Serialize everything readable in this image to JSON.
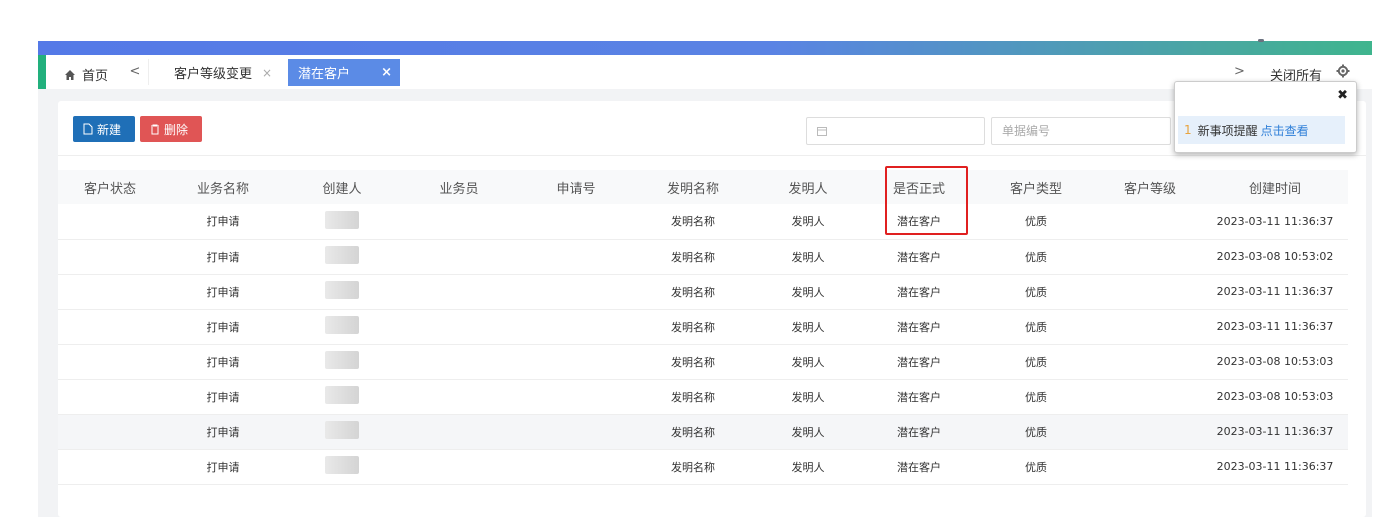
{
  "tabs": {
    "home": "首页",
    "scroll_left": "<",
    "items": [
      {
        "label": "客户等级变更",
        "close": "×"
      },
      {
        "label": "潜在客户",
        "close": "×"
      }
    ],
    "scroll_right": ">",
    "close_all": "关闭所有"
  },
  "toolbar": {
    "new_label": "新建",
    "delete_label": "删除"
  },
  "filters": {
    "date_placeholder": "",
    "number_placeholder": "单据编号"
  },
  "notification": {
    "close": "✖",
    "count": "1",
    "text": "新事项提醒",
    "link": "点击查看"
  },
  "table": {
    "columns": [
      "客户状态",
      "业务名称",
      "创建人",
      "业务员",
      "申请号",
      "发明名称",
      "发明人",
      "是否正式",
      "客户类型",
      "客户等级",
      "创建时间"
    ],
    "rows": [
      {
        "status": "",
        "business": "打申请",
        "creator": "",
        "salesman": "",
        "app_no": "",
        "invention": "发明名称",
        "inventor": "发明人",
        "formal": "潜在客户",
        "ctype": "优质",
        "level": "",
        "created": "2023-03-11 11:36:37"
      },
      {
        "status": "",
        "business": "打申请",
        "creator": "",
        "salesman": "",
        "app_no": "",
        "invention": "发明名称",
        "inventor": "发明人",
        "formal": "潜在客户",
        "ctype": "优质",
        "level": "",
        "created": "2023-03-08 10:53:02"
      },
      {
        "status": "",
        "business": "打申请",
        "creator": "",
        "salesman": "",
        "app_no": "",
        "invention": "发明名称",
        "inventor": "发明人",
        "formal": "潜在客户",
        "ctype": "优质",
        "level": "",
        "created": "2023-03-11 11:36:37"
      },
      {
        "status": "",
        "business": "打申请",
        "creator": "",
        "salesman": "",
        "app_no": "",
        "invention": "发明名称",
        "inventor": "发明人",
        "formal": "潜在客户",
        "ctype": "优质",
        "level": "",
        "created": "2023-03-11 11:36:37"
      },
      {
        "status": "",
        "business": "打申请",
        "creator": "",
        "salesman": "",
        "app_no": "",
        "invention": "发明名称",
        "inventor": "发明人",
        "formal": "潜在客户",
        "ctype": "优质",
        "level": "",
        "created": "2023-03-08 10:53:03"
      },
      {
        "status": "",
        "business": "打申请",
        "creator": "",
        "salesman": "",
        "app_no": "",
        "invention": "发明名称",
        "inventor": "发明人",
        "formal": "潜在客户",
        "ctype": "优质",
        "level": "",
        "created": "2023-03-08 10:53:03"
      },
      {
        "status": "",
        "business": "打申请",
        "creator": "",
        "salesman": "",
        "app_no": "",
        "invention": "发明名称",
        "inventor": "发明人",
        "formal": "潜在客户",
        "ctype": "优质",
        "level": "",
        "created": "2023-03-11 11:36:37"
      },
      {
        "status": "",
        "business": "打申请",
        "creator": "",
        "salesman": "",
        "app_no": "",
        "invention": "发明名称",
        "inventor": "发明人",
        "formal": "潜在客户",
        "ctype": "优质",
        "level": "",
        "created": "2023-03-11 11:36:37"
      }
    ]
  },
  "colors": {
    "tab_active": "#5b8be6",
    "btn_new": "#1f6fb7",
    "btn_delete": "#e05555",
    "highlight": "#e02020"
  }
}
